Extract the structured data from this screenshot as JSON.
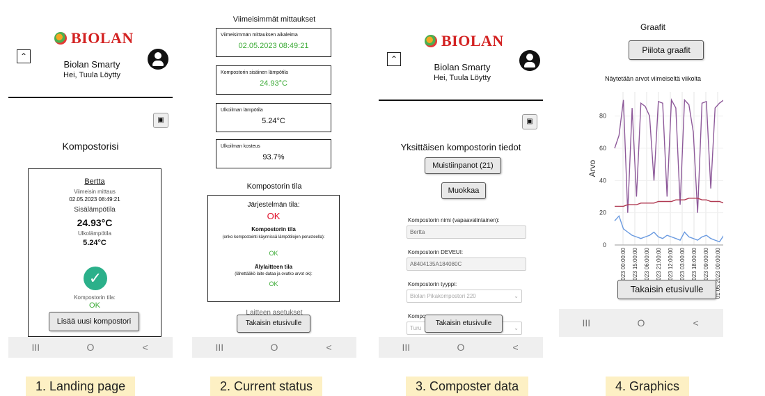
{
  "app": {
    "brand": "BIOLAN",
    "title": "Biolan Smarty",
    "greeting": "Hei, Tuula Löytty"
  },
  "nav": {
    "recents": "III",
    "home": "O",
    "back": "<"
  },
  "screen1": {
    "heading": "Kompostorisi",
    "card": {
      "name": "Bertta",
      "last_measure_label": "Viimeisin mittaus",
      "last_measure_value": "02.05.2023 08:49:21",
      "inside_temp_label": "Sisälämpötila",
      "inside_temp_value": "24.93°C",
      "outside_temp_label": "Ulkolämpötila",
      "outside_temp_value": "5.24°C",
      "status_label": "Kompostorin tila:",
      "status_value": "OK"
    },
    "add_button": "Lisää uusi kompostori"
  },
  "screen2": {
    "heading": "Viimeisimmät mittaukset",
    "m1_label": "Viimeisimmän mittauksen aikaleima",
    "m1_value": "02.05.2023 08:49:21",
    "m2_label": "Kompostorin sisäinen lämpötila",
    "m2_value": "24.93°C",
    "m3_label": "Ulkoilman lämpötila",
    "m3_value": "5.24°C",
    "m4_label": "Ulkoilman kosteus",
    "m4_value": "93.7%",
    "status_heading": "Kompostorin tila",
    "sys_label": "Järjestelmän tila:",
    "sys_value": "OK",
    "comp_label": "Kompostorin tila",
    "comp_desc": "(onko kompostointi käynnissä lämpötilojen perusteella):",
    "comp_value": "OK",
    "dev_label": "Älylaitteen tila",
    "dev_desc": "(lähettääkö laite dataa ja ovatko arvot ok):",
    "dev_value": "OK",
    "partial_heading": "Laitteen asetukset",
    "back_button": "Takaisin etusivulle"
  },
  "screen3": {
    "heading": "Yksittäisen kompostorin tiedot",
    "notes_button": "Muistiinpanot (21)",
    "edit_button": "Muokkaa",
    "name_label": "Kompostorin nimi (vapaavalintainen):",
    "name_value": "Bertta",
    "deveui_label": "Kompostorin DEVEUI:",
    "deveui_value": "A8404135A184080C",
    "type_label": "Kompostorin tyyppi:",
    "type_value": "Biolan Pikakompostori 220",
    "partial_label": "Kompo",
    "partial_value": "Turu",
    "back_button": "Takaisin etusivulle"
  },
  "screen4": {
    "heading": "Graafit",
    "hide_button": "Piilota graafit",
    "subtitle": "Näytetään arvot viimeiseltä viikolta",
    "back_button": "Takaisin etusivulle"
  },
  "captions": [
    "1. Landing page",
    "2. Current status",
    "3. Composter data",
    "4. Graphics"
  ],
  "chart_data": {
    "type": "line",
    "ylabel": "Arvo",
    "ylim": [
      0,
      95
    ],
    "yticks": [
      0,
      20,
      40,
      60,
      80
    ],
    "xtick_labels": [
      "26.04.2023 00:00:00",
      "26.04.2023 15:00:00",
      "27.04.2023 06:00:00",
      "27.04.2023 21:00:00",
      "28.04.2023 12:00:00",
      "29.04.2023 03:00:00",
      "29.04.2023 18:00:00",
      "30.04.2023 09:00:00",
      "01.05.2023 00:00:00",
      "01.05.2023 15:00:00",
      "02.05.2023 06:00:00"
    ],
    "series": [
      {
        "color": "#8e5a9a",
        "values": [
          60,
          68,
          90,
          20,
          85,
          30,
          88,
          86,
          80,
          40,
          89,
          88,
          30,
          90,
          85,
          25,
          90,
          87,
          70,
          20,
          88,
          89,
          35,
          85,
          88,
          90,
          40,
          92,
          0,
          88
        ]
      },
      {
        "color": "#b03a52",
        "values": [
          24,
          24,
          24,
          25,
          25,
          25,
          26,
          26,
          26,
          26,
          27,
          27,
          27,
          27,
          28,
          28,
          28,
          29,
          29,
          29,
          28,
          28,
          27,
          27,
          27,
          26,
          26,
          25,
          25,
          24
        ]
      },
      {
        "color": "#6a9ae0",
        "values": [
          15,
          18,
          10,
          8,
          6,
          5,
          4,
          5,
          6,
          8,
          5,
          4,
          6,
          5,
          4,
          3,
          8,
          5,
          4,
          3,
          5,
          6,
          4,
          3,
          2,
          6,
          3,
          5,
          4,
          6
        ]
      }
    ]
  }
}
